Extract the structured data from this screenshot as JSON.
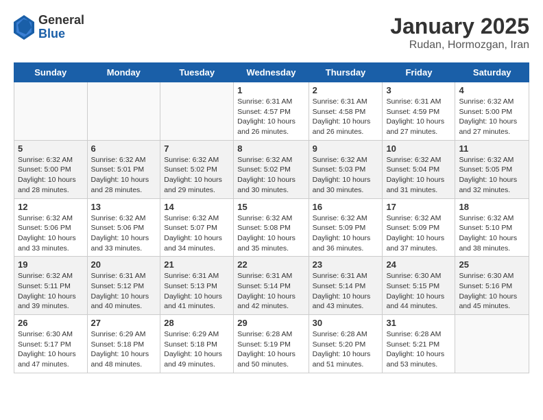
{
  "header": {
    "logo": {
      "general": "General",
      "blue": "Blue"
    },
    "title": "January 2025",
    "location": "Rudan, Hormozgan, Iran"
  },
  "weekdays": [
    "Sunday",
    "Monday",
    "Tuesday",
    "Wednesday",
    "Thursday",
    "Friday",
    "Saturday"
  ],
  "weeks": [
    {
      "bg": "white",
      "days": [
        {
          "num": "",
          "info": ""
        },
        {
          "num": "",
          "info": ""
        },
        {
          "num": "",
          "info": ""
        },
        {
          "num": "1",
          "info": "Sunrise: 6:31 AM\nSunset: 4:57 PM\nDaylight: 10 hours\nand 26 minutes."
        },
        {
          "num": "2",
          "info": "Sunrise: 6:31 AM\nSunset: 4:58 PM\nDaylight: 10 hours\nand 26 minutes."
        },
        {
          "num": "3",
          "info": "Sunrise: 6:31 AM\nSunset: 4:59 PM\nDaylight: 10 hours\nand 27 minutes."
        },
        {
          "num": "4",
          "info": "Sunrise: 6:32 AM\nSunset: 5:00 PM\nDaylight: 10 hours\nand 27 minutes."
        }
      ]
    },
    {
      "bg": "light",
      "days": [
        {
          "num": "5",
          "info": "Sunrise: 6:32 AM\nSunset: 5:00 PM\nDaylight: 10 hours\nand 28 minutes."
        },
        {
          "num": "6",
          "info": "Sunrise: 6:32 AM\nSunset: 5:01 PM\nDaylight: 10 hours\nand 28 minutes."
        },
        {
          "num": "7",
          "info": "Sunrise: 6:32 AM\nSunset: 5:02 PM\nDaylight: 10 hours\nand 29 minutes."
        },
        {
          "num": "8",
          "info": "Sunrise: 6:32 AM\nSunset: 5:02 PM\nDaylight: 10 hours\nand 30 minutes."
        },
        {
          "num": "9",
          "info": "Sunrise: 6:32 AM\nSunset: 5:03 PM\nDaylight: 10 hours\nand 30 minutes."
        },
        {
          "num": "10",
          "info": "Sunrise: 6:32 AM\nSunset: 5:04 PM\nDaylight: 10 hours\nand 31 minutes."
        },
        {
          "num": "11",
          "info": "Sunrise: 6:32 AM\nSunset: 5:05 PM\nDaylight: 10 hours\nand 32 minutes."
        }
      ]
    },
    {
      "bg": "white",
      "days": [
        {
          "num": "12",
          "info": "Sunrise: 6:32 AM\nSunset: 5:06 PM\nDaylight: 10 hours\nand 33 minutes."
        },
        {
          "num": "13",
          "info": "Sunrise: 6:32 AM\nSunset: 5:06 PM\nDaylight: 10 hours\nand 33 minutes."
        },
        {
          "num": "14",
          "info": "Sunrise: 6:32 AM\nSunset: 5:07 PM\nDaylight: 10 hours\nand 34 minutes."
        },
        {
          "num": "15",
          "info": "Sunrise: 6:32 AM\nSunset: 5:08 PM\nDaylight: 10 hours\nand 35 minutes."
        },
        {
          "num": "16",
          "info": "Sunrise: 6:32 AM\nSunset: 5:09 PM\nDaylight: 10 hours\nand 36 minutes."
        },
        {
          "num": "17",
          "info": "Sunrise: 6:32 AM\nSunset: 5:09 PM\nDaylight: 10 hours\nand 37 minutes."
        },
        {
          "num": "18",
          "info": "Sunrise: 6:32 AM\nSunset: 5:10 PM\nDaylight: 10 hours\nand 38 minutes."
        }
      ]
    },
    {
      "bg": "light",
      "days": [
        {
          "num": "19",
          "info": "Sunrise: 6:32 AM\nSunset: 5:11 PM\nDaylight: 10 hours\nand 39 minutes."
        },
        {
          "num": "20",
          "info": "Sunrise: 6:31 AM\nSunset: 5:12 PM\nDaylight: 10 hours\nand 40 minutes."
        },
        {
          "num": "21",
          "info": "Sunrise: 6:31 AM\nSunset: 5:13 PM\nDaylight: 10 hours\nand 41 minutes."
        },
        {
          "num": "22",
          "info": "Sunrise: 6:31 AM\nSunset: 5:14 PM\nDaylight: 10 hours\nand 42 minutes."
        },
        {
          "num": "23",
          "info": "Sunrise: 6:31 AM\nSunset: 5:14 PM\nDaylight: 10 hours\nand 43 minutes."
        },
        {
          "num": "24",
          "info": "Sunrise: 6:30 AM\nSunset: 5:15 PM\nDaylight: 10 hours\nand 44 minutes."
        },
        {
          "num": "25",
          "info": "Sunrise: 6:30 AM\nSunset: 5:16 PM\nDaylight: 10 hours\nand 45 minutes."
        }
      ]
    },
    {
      "bg": "white",
      "days": [
        {
          "num": "26",
          "info": "Sunrise: 6:30 AM\nSunset: 5:17 PM\nDaylight: 10 hours\nand 47 minutes."
        },
        {
          "num": "27",
          "info": "Sunrise: 6:29 AM\nSunset: 5:18 PM\nDaylight: 10 hours\nand 48 minutes."
        },
        {
          "num": "28",
          "info": "Sunrise: 6:29 AM\nSunset: 5:18 PM\nDaylight: 10 hours\nand 49 minutes."
        },
        {
          "num": "29",
          "info": "Sunrise: 6:28 AM\nSunset: 5:19 PM\nDaylight: 10 hours\nand 50 minutes."
        },
        {
          "num": "30",
          "info": "Sunrise: 6:28 AM\nSunset: 5:20 PM\nDaylight: 10 hours\nand 51 minutes."
        },
        {
          "num": "31",
          "info": "Sunrise: 6:28 AM\nSunset: 5:21 PM\nDaylight: 10 hours\nand 53 minutes."
        },
        {
          "num": "",
          "info": ""
        }
      ]
    }
  ]
}
